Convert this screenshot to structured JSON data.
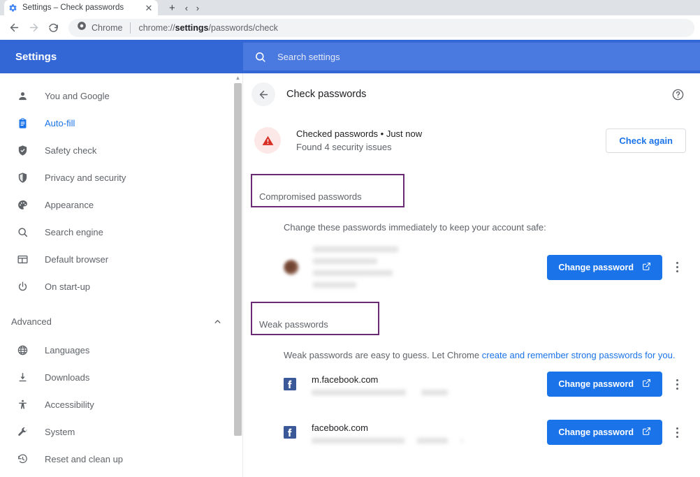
{
  "browser": {
    "tab": {
      "title": "Settings – Check passwords",
      "favicon": "settings-gear-icon",
      "close": "✕"
    },
    "new_tab_label": "+",
    "tab_list_label": "‹ ›",
    "nav": {
      "back": "←",
      "forward": "→",
      "reload": "⟳"
    },
    "omnibox": {
      "chip_icon": "chrome-icon",
      "chip_label": "Chrome",
      "url_prefix": "chrome://",
      "url_bold": "settings",
      "url_suffix": "/passwords/check"
    }
  },
  "settings": {
    "brand": "Settings",
    "search": {
      "icon": "search-icon",
      "placeholder": "Search settings",
      "value": ""
    }
  },
  "sidebar": {
    "items": [
      {
        "label": "You and Google",
        "icon": "person-icon",
        "active": false
      },
      {
        "label": "Auto-fill",
        "icon": "clipboard-icon",
        "active": true
      },
      {
        "label": "Safety check",
        "icon": "shield-check-icon",
        "active": false
      },
      {
        "label": "Privacy and security",
        "icon": "shield-icon",
        "active": false
      },
      {
        "label": "Appearance",
        "icon": "palette-icon",
        "active": false
      },
      {
        "label": "Search engine",
        "icon": "search-icon",
        "active": false
      },
      {
        "label": "Default browser",
        "icon": "browser-window-icon",
        "active": false
      },
      {
        "label": "On start-up",
        "icon": "power-icon",
        "active": false
      }
    ],
    "advanced": {
      "label": "Advanced",
      "chevron": "chevron-up-icon"
    },
    "advanced_items": [
      {
        "label": "Languages",
        "icon": "globe-icon"
      },
      {
        "label": "Downloads",
        "icon": "download-icon"
      },
      {
        "label": "Accessibility",
        "icon": "accessibility-icon"
      },
      {
        "label": "System",
        "icon": "wrench-icon"
      },
      {
        "label": "Reset and clean up",
        "icon": "history-restore-icon"
      }
    ]
  },
  "main": {
    "header": {
      "back_icon": "back-arrow-icon",
      "title": "Check passwords",
      "help_icon": "help-circle-icon"
    },
    "status": {
      "icon": "warning-triangle-icon",
      "line1": "Checked passwords • Just now",
      "line2": "Found 4 security issues",
      "check_again_label": "Check again"
    },
    "compromised": {
      "heading": "Compromised passwords",
      "description": "Change these passwords immediately to keep your account safe:",
      "entry": {
        "favicon": "redacted-favicon",
        "redacted": true,
        "change_label": "Change password",
        "external_icon": "external-link-icon",
        "menu_icon": "more-vertical-icon"
      },
      "highlight_color": "#6a2b74"
    },
    "weak": {
      "heading": "Weak passwords",
      "description_prefix": "Weak passwords are easy to guess. Let Chrome ",
      "description_link": "create and remember strong passwords for you.",
      "highlight_color": "#6a2b74",
      "entries": [
        {
          "site": "m.facebook.com",
          "favicon": "facebook-icon",
          "username_redacted": true,
          "change_label": "Change password",
          "external_icon": "external-link-icon",
          "menu_icon": "more-vertical-icon"
        },
        {
          "site": "facebook.com",
          "favicon": "facebook-icon",
          "username_redacted": true,
          "change_label": "Change password",
          "external_icon": "external-link-icon",
          "menu_icon": "more-vertical-icon"
        }
      ]
    }
  },
  "colors": {
    "settings_header_blue": "#3367d6",
    "accent_blue": "#1a73e8",
    "highlight_purple": "#6a2b74",
    "warning_red": "#d93025",
    "facebook_blue": "#3b5998"
  }
}
